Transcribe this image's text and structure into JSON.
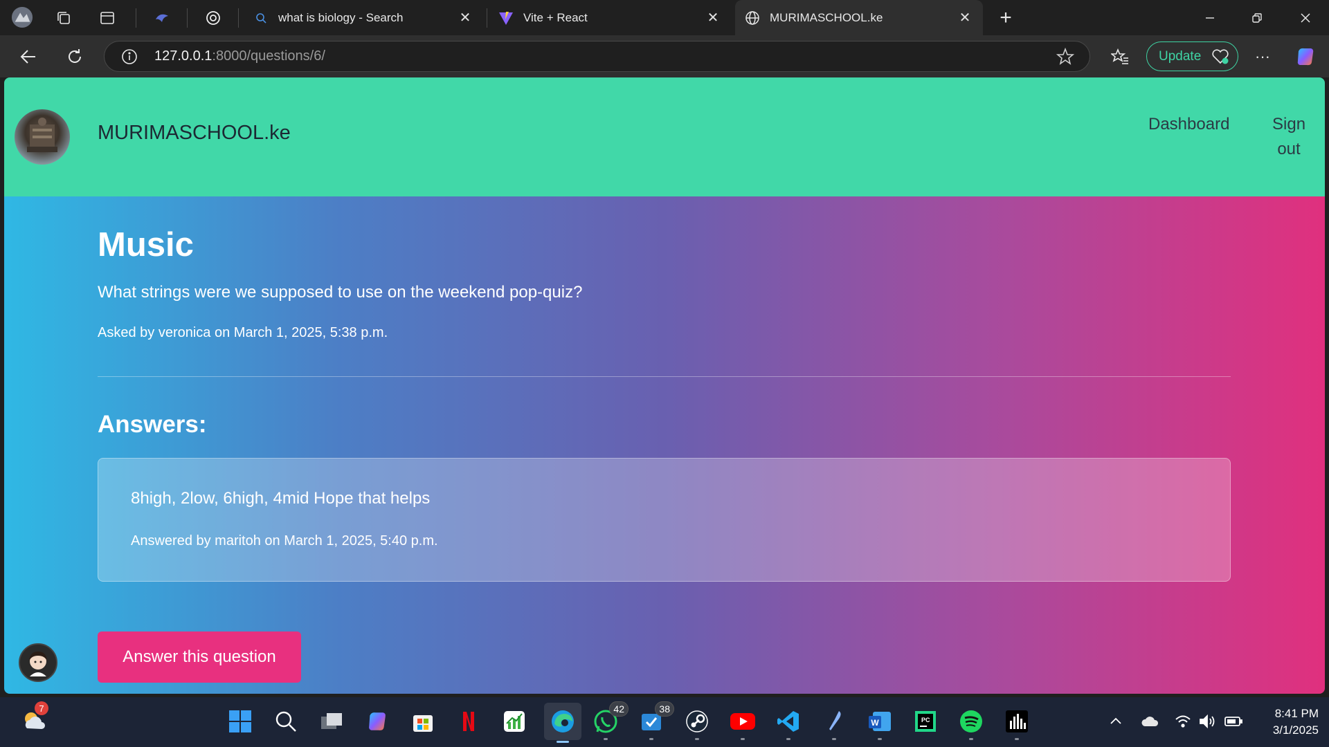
{
  "browser": {
    "tabs": [
      {
        "title": "what is biology - Search"
      },
      {
        "title": "Vite + React"
      },
      {
        "title": "MURIMASCHOOL.ke"
      }
    ],
    "url_host": "127.0.0.1",
    "url_rest": ":8000/questions/6/",
    "update_label": "Update"
  },
  "site": {
    "brand": "MURIMASCHOOL.ke",
    "nav": {
      "dashboard": "Dashboard",
      "signout_line1": "Sign",
      "signout_line2": "out"
    }
  },
  "question": {
    "title": "Music",
    "body": "What strings were we supposed to use on the weekend pop-quiz?",
    "meta": "Asked by veronica on March 1, 2025, 5:38 p.m."
  },
  "answers": {
    "heading": "Answers:",
    "items": [
      {
        "text": "8high, 2low, 6high, 4mid Hope that helps",
        "meta": "Answered by maritoh on March 1, 2025, 5:40 p.m."
      }
    ],
    "button_label": "Answer this question"
  },
  "taskbar": {
    "weather_badge": "7",
    "whatsapp_badge": "42",
    "todo_badge": "38",
    "time": "8:41 PM",
    "date": "3/1/2025"
  },
  "colors": {
    "header": "#41d8a8",
    "gradient_start": "#2fb8e4",
    "gradient_end": "#e0307e",
    "button": "#e8307f"
  }
}
